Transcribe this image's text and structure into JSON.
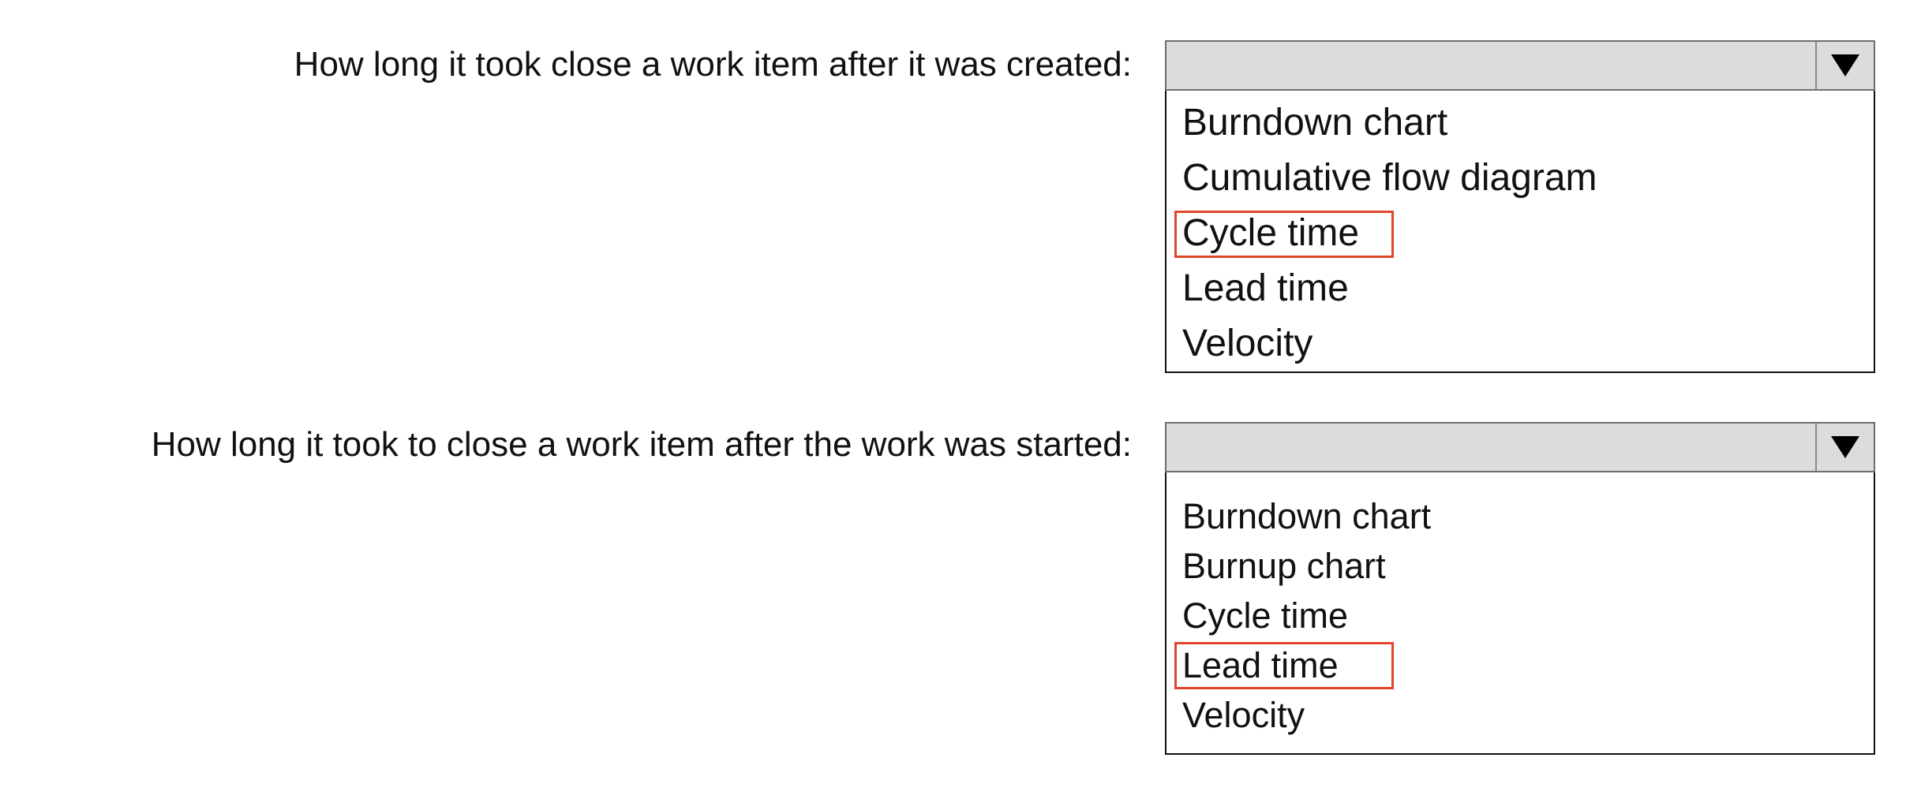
{
  "questions": [
    {
      "prompt": "How long it took close a work item after it was created:",
      "dropdown": {
        "selected_value": "",
        "arrow_icon": "triangle-down-icon",
        "options": [
          {
            "label": "Burndown chart",
            "selected": false
          },
          {
            "label": "Cumulative flow diagram",
            "selected": false
          },
          {
            "label": "Cycle time",
            "selected": true
          },
          {
            "label": "Lead time",
            "selected": false
          },
          {
            "label": "Velocity",
            "selected": false
          }
        ]
      }
    },
    {
      "prompt": "How long it took to close a work item after the work was started:",
      "dropdown": {
        "selected_value": "",
        "arrow_icon": "triangle-down-icon",
        "options": [
          {
            "label": "Burndown chart",
            "selected": false
          },
          {
            "label": "Burnup chart",
            "selected": false
          },
          {
            "label": "Cycle time",
            "selected": false
          },
          {
            "label": "Lead time",
            "selected": true
          },
          {
            "label": "Velocity",
            "selected": false
          }
        ]
      }
    }
  ],
  "colors": {
    "selection_box": "#e0462b",
    "header_background": "#dcdcdc",
    "border": "#111111"
  }
}
